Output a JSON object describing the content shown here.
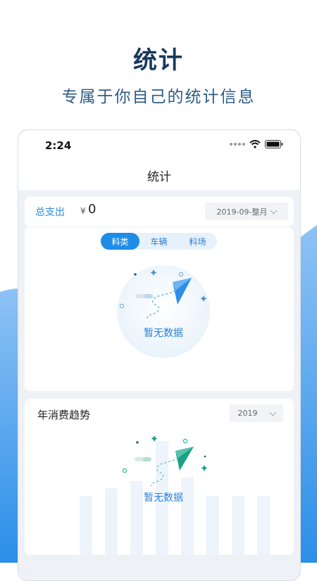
{
  "hero": {
    "title": "统计",
    "subtitle": "专属于你自己的统计信息"
  },
  "status_bar": {
    "time": "2:24",
    "icons": [
      "signal-dots-icon",
      "wifi-icon",
      "battery-icon"
    ]
  },
  "nav": {
    "title": "统计"
  },
  "expense": {
    "label": "总支出",
    "currency": "¥",
    "value": "0",
    "period": "2019-09-整月"
  },
  "category_tabs": {
    "items": [
      "料类",
      "车辆",
      "料场"
    ],
    "active": "料类"
  },
  "category_empty": {
    "text": "暂无数据"
  },
  "trend": {
    "title": "年消费趋势",
    "year": "2019",
    "empty_text": "暂无数据"
  },
  "colors": {
    "accent": "#1e8de8",
    "hero_title": "#17385f",
    "background": "#eef1f6"
  }
}
